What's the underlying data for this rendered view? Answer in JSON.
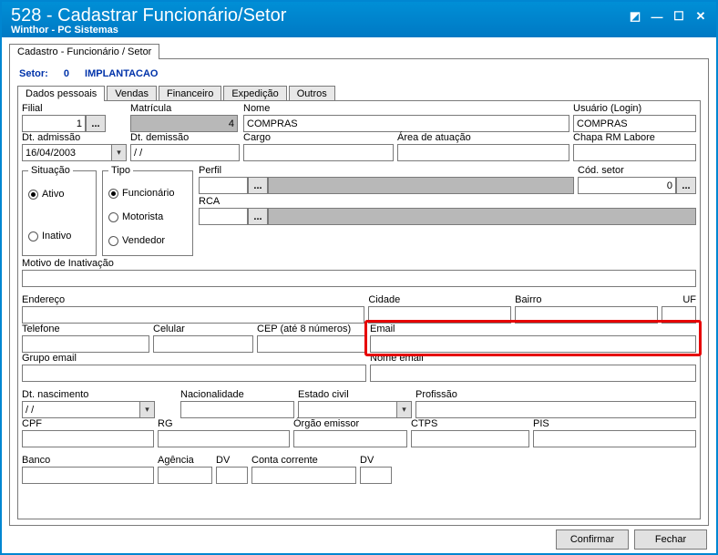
{
  "titlebar": {
    "title": "528 - Cadastrar Funcionário/Setor",
    "subtitle": "Winthor - PC Sistemas"
  },
  "outer_tab": {
    "label": "Cadastro - Funcionário / Setor"
  },
  "setor": {
    "label": "Setor:",
    "code": "0",
    "name": "IMPLANTACAO"
  },
  "inner_tabs": {
    "dados": "Dados pessoais",
    "vendas": "Vendas",
    "financeiro": "Financeiro",
    "expedicao": "Expedição",
    "outros": "Outros"
  },
  "fields": {
    "filial": {
      "label": "Filial",
      "value": "1"
    },
    "matricula": {
      "label": "Matrícula",
      "value": "4"
    },
    "nome": {
      "label": "Nome",
      "value": "COMPRAS"
    },
    "usuario": {
      "label": "Usuário (Login)",
      "value": "COMPRAS"
    },
    "dt_admissao": {
      "label": "Dt. admissão",
      "value": "16/04/2003"
    },
    "dt_demissao": {
      "label": "Dt. demissão",
      "value": "  /  /"
    },
    "cargo": {
      "label": "Cargo",
      "value": ""
    },
    "area_atuacao": {
      "label": "Área de atuação",
      "value": ""
    },
    "chapa_rm": {
      "label": "Chapa RM Labore",
      "value": ""
    },
    "perfil": {
      "label": "Perfil",
      "value": ""
    },
    "cod_setor": {
      "label": "Cód. setor",
      "value": "0"
    },
    "rca": {
      "label": "RCA",
      "value": ""
    },
    "motivo_inat": {
      "label": "Motivo de Inativação",
      "value": ""
    },
    "endereco": {
      "label": "Endereço",
      "value": ""
    },
    "cidade": {
      "label": "Cidade",
      "value": ""
    },
    "bairro": {
      "label": "Bairro",
      "value": ""
    },
    "uf": {
      "label": "UF",
      "value": ""
    },
    "telefone": {
      "label": "Telefone",
      "value": ""
    },
    "celular": {
      "label": "Celular",
      "value": ""
    },
    "cep": {
      "label": "CEP (até 8 números)",
      "value": ""
    },
    "email": {
      "label": "Email",
      "value": ""
    },
    "grupo_email": {
      "label": "Grupo email",
      "value": ""
    },
    "nome_email": {
      "label": "Nome email",
      "value": ""
    },
    "dt_nasc": {
      "label": "Dt. nascimento",
      "value": "  /  /"
    },
    "nacionalidade": {
      "label": "Nacionalidade",
      "value": ""
    },
    "estado_civil": {
      "label": "Estado civil",
      "value": ""
    },
    "profissao": {
      "label": "Profissão",
      "value": ""
    },
    "cpf": {
      "label": "CPF",
      "value": ""
    },
    "rg": {
      "label": "RG",
      "value": ""
    },
    "orgao_emissor": {
      "label": "Órgão emissor",
      "value": ""
    },
    "ctps": {
      "label": "CTPS",
      "value": ""
    },
    "pis": {
      "label": "PIS",
      "value": ""
    },
    "banco": {
      "label": "Banco",
      "value": ""
    },
    "agencia": {
      "label": "Agência",
      "value": ""
    },
    "dv1": {
      "label": "DV",
      "value": ""
    },
    "conta_corrente": {
      "label": "Conta corrente",
      "value": ""
    },
    "dv2": {
      "label": "DV",
      "value": ""
    }
  },
  "situacao": {
    "legend": "Situação",
    "ativo": "Ativo",
    "inativo": "Inativo",
    "selected": "ativo"
  },
  "tipo": {
    "legend": "Tipo",
    "funcionario": "Funcionário",
    "motorista": "Motorista",
    "vendedor": "Vendedor",
    "selected": "funcionario"
  },
  "buttons": {
    "confirmar": "Confirmar",
    "fechar": "Fechar",
    "ellipsis": "..."
  }
}
